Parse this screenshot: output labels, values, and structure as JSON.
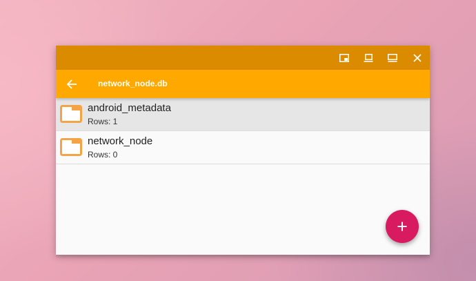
{
  "window": {
    "controls": [
      {
        "name": "pip-icon"
      },
      {
        "name": "restore-icon"
      },
      {
        "name": "maximize-icon"
      },
      {
        "name": "close-icon"
      }
    ]
  },
  "appbar": {
    "back_icon": "arrow-left-icon",
    "title": "network_node.db"
  },
  "tables": [
    {
      "name": "android_metadata",
      "rows": "Rows: 1",
      "selected": true
    },
    {
      "name": "network_node",
      "rows": "Rows: 0",
      "selected": false
    }
  ],
  "fab": {
    "icon": "plus-icon",
    "symbol": "+"
  },
  "colors": {
    "titlebar": "#db8b00",
    "appbar": "#ffa800",
    "folder_icon": "#f5a347",
    "fab": "#d81b60",
    "selected_row": "#e6e6e6"
  }
}
